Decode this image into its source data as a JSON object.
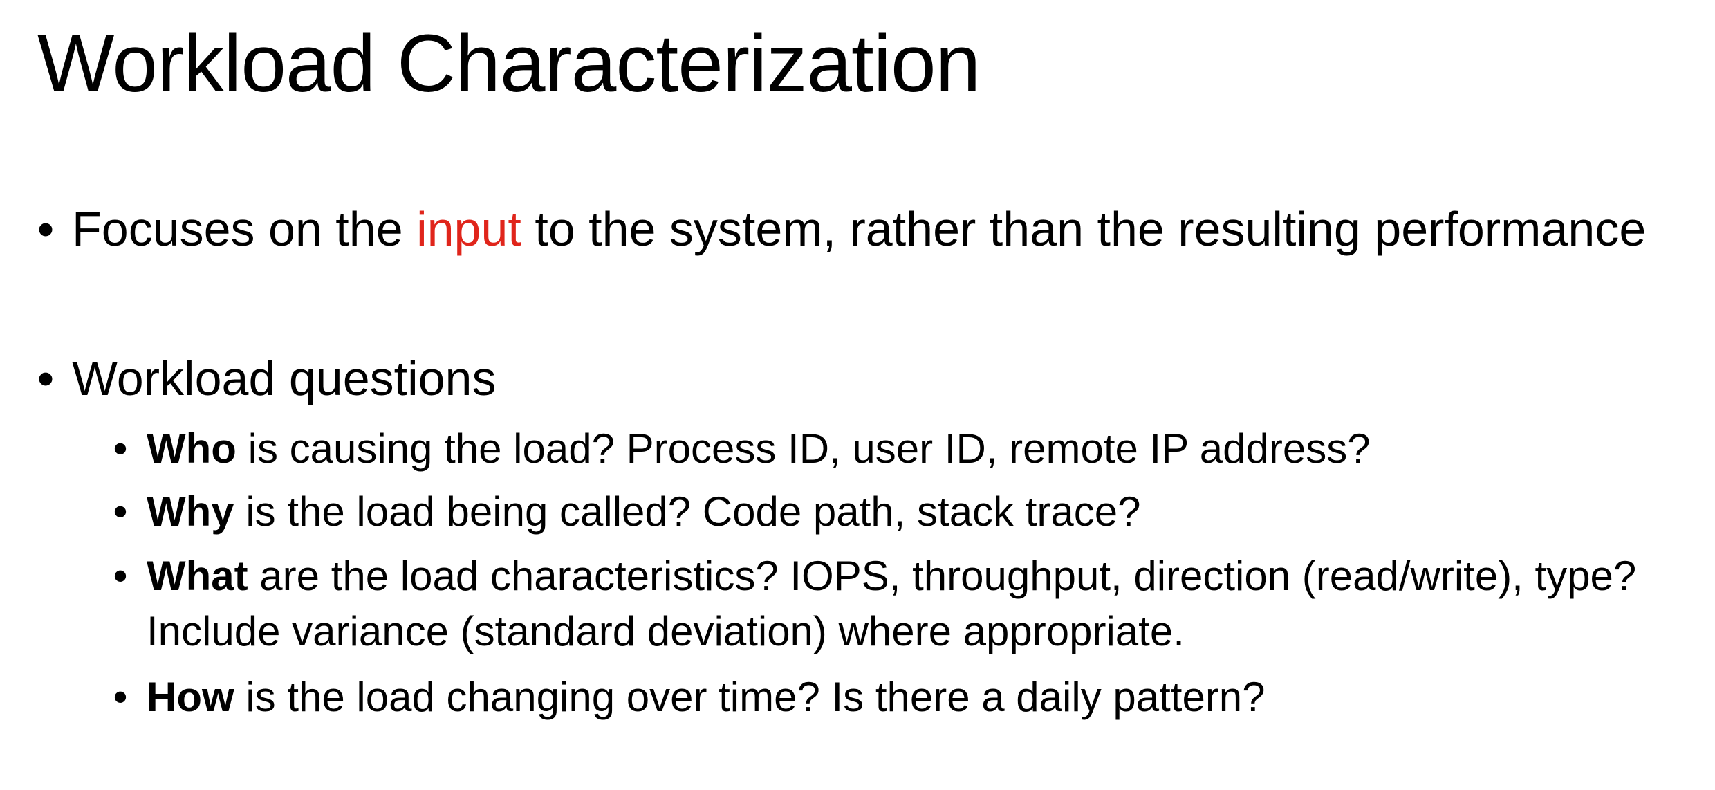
{
  "slide": {
    "title": "Workload Characterization",
    "bullet_char": "•",
    "point1": {
      "before": "Focuses on the ",
      "highlight": "input",
      "after": " to the system, rather than the resulting performance",
      "highlight_color": "#e0251b"
    },
    "point2": {
      "text": "Workload questions",
      "sub": [
        {
          "keyword": "Who",
          "text": " is causing the load? Process ID, user ID, remote IP address?"
        },
        {
          "keyword": "Why",
          "text": " is the load being called? Code path, stack trace?"
        },
        {
          "keyword": "What",
          "text": " are the load characteristics? IOPS, throughput, direction (read/write), type? Include variance (standard deviation) where appropriate."
        },
        {
          "keyword": "How",
          "text": " is the load changing over time? Is there a daily pattern?"
        }
      ]
    }
  }
}
